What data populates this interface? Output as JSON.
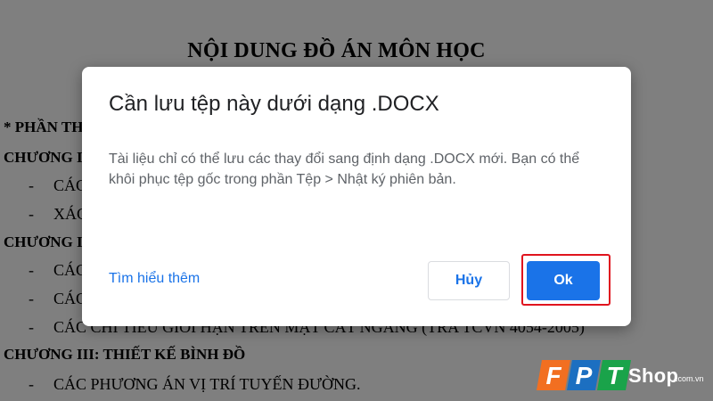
{
  "document": {
    "title": "NỘI DUNG ĐỒ ÁN MÔN HỌC",
    "lines": [
      "* PHẦN THUYẾT MINH",
      "CHƯƠNG I",
      "CÁC",
      "XÁC",
      "CHƯƠNG II",
      "CÁC",
      "CÁC",
      "CÁC CHỈ TIÊU GIỚI HẠN TRÊN MẶT CẮT NGANG (TRA TCVN 4054-2005)",
      "CHƯƠNG III: THIẾT KẾ BÌNH ĐỒ",
      "CÁC PHƯƠNG ÁN VỊ TRÍ TUYẾN ĐƯỜNG."
    ],
    "bullet_dash": "-"
  },
  "dialog": {
    "title": "Cần lưu tệp này dưới dạng .DOCX",
    "body": "Tài liệu chỉ có thể lưu các thay đổi sang định dạng .DOCX mới. Bạn có thể khôi phục tệp gốc trong phần Tệp > Nhật ký phiên bản.",
    "learn_more": "Tìm hiểu thêm",
    "cancel_label": "Hủy",
    "ok_label": "Ok"
  },
  "watermark": {
    "letters": [
      "F",
      "P",
      "T"
    ],
    "brand": "Shop",
    "domain": ".com.vn"
  },
  "colors": {
    "accent": "#1a73e8",
    "highlight": "#e0141e",
    "logo_orange": "#f26f21",
    "logo_blue": "#1c6fc1",
    "logo_green": "#1aa34a"
  }
}
